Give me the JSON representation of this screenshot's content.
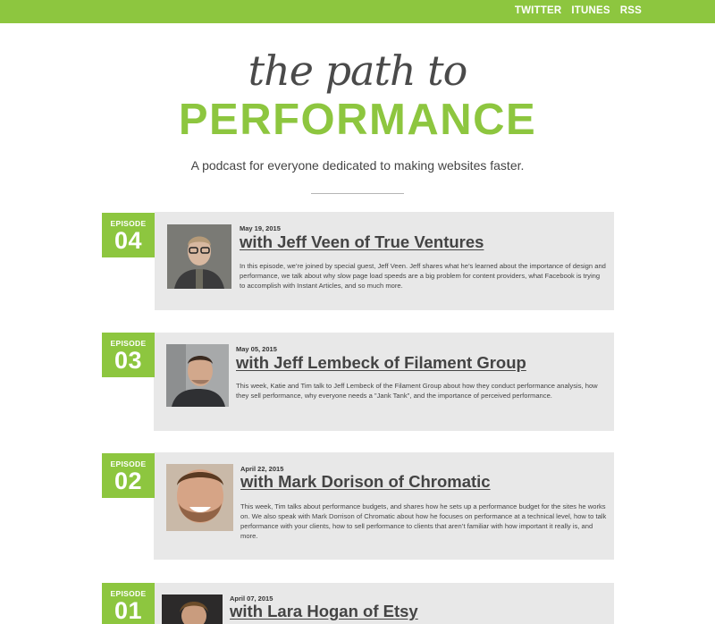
{
  "nav": {
    "twitter": "TWITTER",
    "itunes": "ITUNES",
    "rss": "RSS"
  },
  "hero": {
    "line1": "the path to",
    "line2": "PERFORMANCE",
    "tagline": "A podcast for everyone dedicated to making websites faster."
  },
  "colors": {
    "accent": "#8dc63f",
    "card": "#e8e8e8",
    "text": "#444444"
  },
  "episodes": [
    {
      "label": "EPISODE",
      "number": "04",
      "date": "May 19, 2015",
      "title": "with Jeff Veen of True Ventures",
      "description": "In this episode, we’re joined by special guest, Jeff Veen. Jeff shares what he’s learned about the importance of design and performance, we talk about why slow page load speeds are a big problem for content providers, what Facebook is trying to accomplish with Instant Articles, and so much more."
    },
    {
      "label": "EPISODE",
      "number": "03",
      "date": "May 05, 2015",
      "title": "with Jeff Lembeck of Filament Group",
      "description": "This week, Katie and Tim talk to Jeff Lembeck of the Filament Group about how they conduct performance analysis, how they sell performance, why everyone needs a \"Jank Tank\", and the importance of perceived performance."
    },
    {
      "label": "EPISODE",
      "number": "02",
      "date": "April 22, 2015",
      "title": "with Mark Dorison of Chromatic",
      "description": "This week, Tim talks about performance budgets, and shares how he sets up a performance budget for the sites he works on. We also speak with Mark Dorrison of Chromatic about how he focuses on performance at a technical level, how to talk performance with your clients, how to sell performance to clients that aren’t familiar with how important it really is, and more."
    },
    {
      "label": "EPISODE",
      "number": "01",
      "date": "April 07, 2015",
      "title": "with Lara Hogan of Etsy",
      "description": ""
    }
  ]
}
